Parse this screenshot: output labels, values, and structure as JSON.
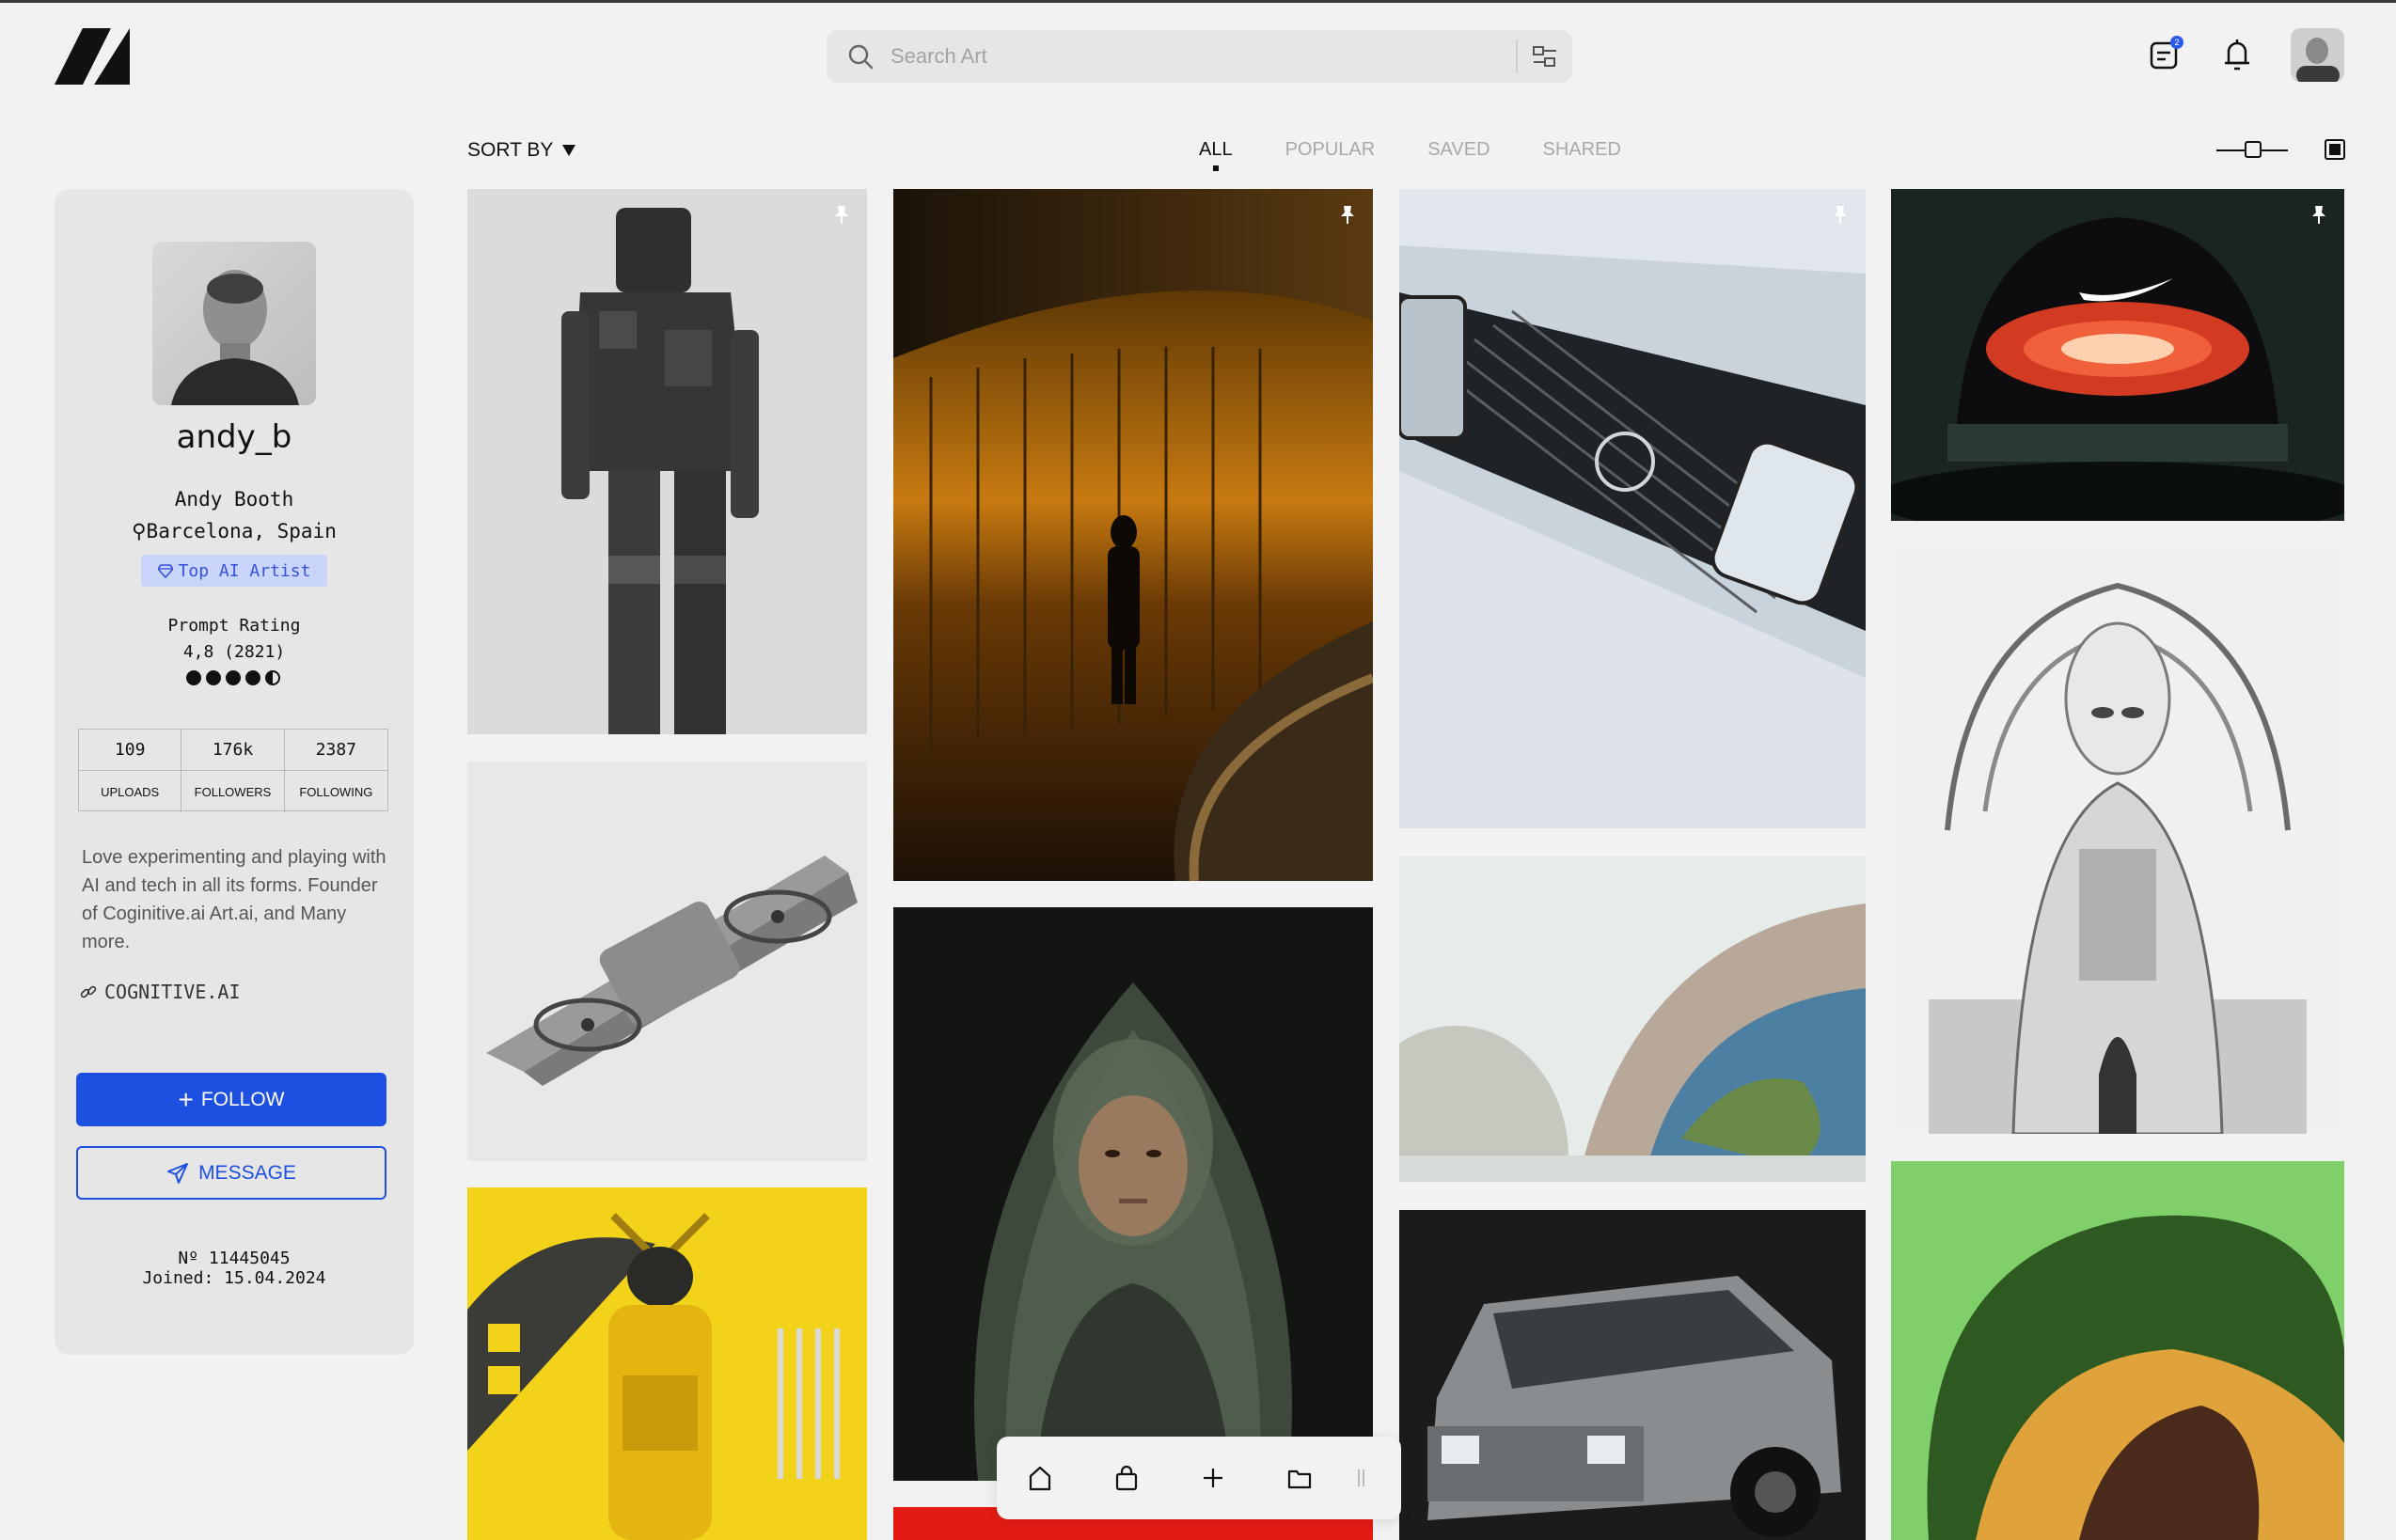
{
  "search": {
    "placeholder": "Search Art"
  },
  "header": {
    "messages_badge": "2",
    "icons": [
      "logo-icon",
      "search-icon",
      "filter-icon",
      "messages-icon",
      "bell-icon",
      "avatar"
    ]
  },
  "toolbar": {
    "sort_label": "SORT BY",
    "tabs": [
      {
        "label": "ALL",
        "active": true
      },
      {
        "label": "POPULAR",
        "active": false
      },
      {
        "label": "SAVED",
        "active": false
      },
      {
        "label": "SHARED",
        "active": false
      }
    ]
  },
  "profile": {
    "username": "andy_b",
    "name": "Andy Booth",
    "location": "Barcelona, Spain",
    "badge": "Top AI Artist",
    "rating_label": "Prompt Rating",
    "rating_value": "4,8 (2821)",
    "rating": 4.5,
    "stats": [
      {
        "value": "109",
        "label": "UPLOADS"
      },
      {
        "value": "176k",
        "label": "FOLLOWERS"
      },
      {
        "value": "2387",
        "label": "FOLLOWING"
      }
    ],
    "bio": "Love experimenting and playing with AI and tech in all its forms. Founder of Coginitive.ai Art.ai, and Many more.",
    "link": "COGNITIVE.AI",
    "follow_label": "FOLLOW",
    "message_label": "MESSAGE",
    "number": "Nº 11445045",
    "joined": "Joined: 15.04.2024"
  },
  "colors": {
    "accent": "#1d4fe0",
    "badge_bg": "#c9d5fa",
    "background": "#f2f2f2",
    "card": "#e6e6e6"
  },
  "gallery": [
    {
      "name": "robot-image",
      "pinned": true
    },
    {
      "name": "drone-image",
      "pinned": false
    },
    {
      "name": "samurai-image",
      "pinned": false
    },
    {
      "name": "corridor-image",
      "pinned": true
    },
    {
      "name": "astronaut-woman-image",
      "pinned": false
    },
    {
      "name": "car-panel-image",
      "pinned": true
    },
    {
      "name": "dome-earth-image",
      "pinned": false
    },
    {
      "name": "suv-image",
      "pinned": false
    },
    {
      "name": "nike-dome-image",
      "pinned": true
    },
    {
      "name": "cyborg-image",
      "pinned": false
    },
    {
      "name": "hat-portrait-image",
      "pinned": false
    }
  ],
  "dock": [
    "home-icon",
    "shop-icon",
    "add-icon",
    "folder-icon",
    "drag-handle"
  ]
}
